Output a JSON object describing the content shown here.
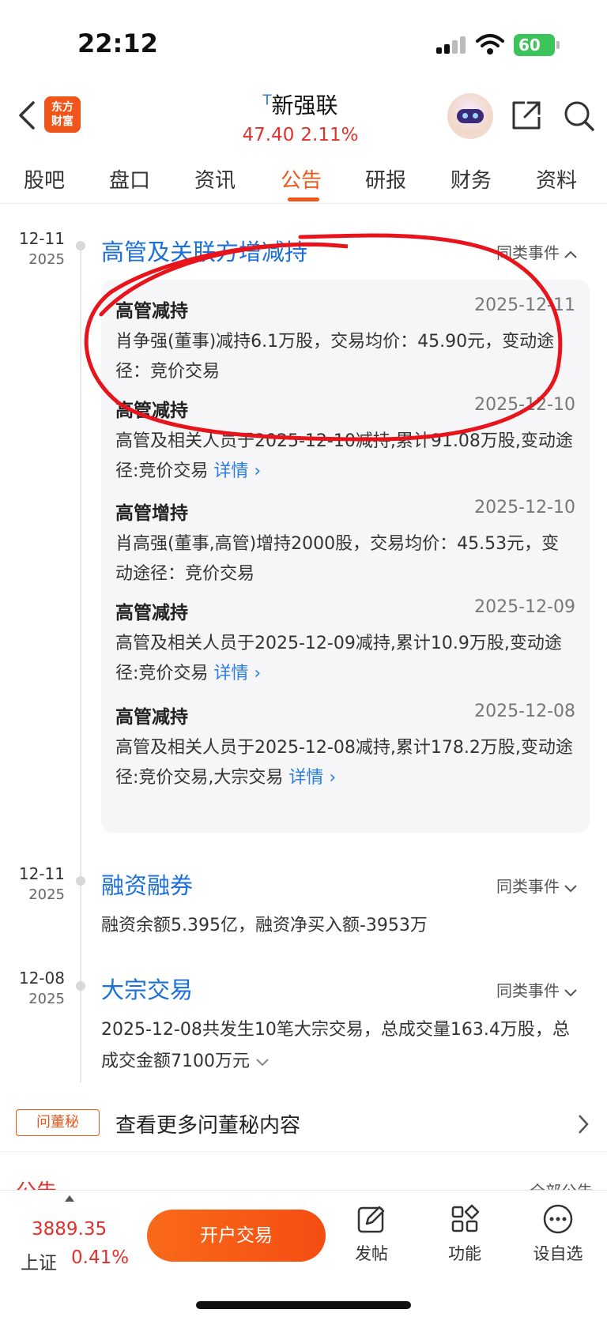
{
  "status_bar": {
    "time": "22:12",
    "battery": "60"
  },
  "header": {
    "logo_line1": "东方",
    "logo_line2": "财富",
    "stock_tag": "T",
    "stock_name": "新强联",
    "price": "47.40",
    "change_pct": "2.11%"
  },
  "tabs": [
    {
      "label": "股吧"
    },
    {
      "label": "盘口"
    },
    {
      "label": "资讯"
    },
    {
      "label": "公告"
    },
    {
      "label": "研报"
    },
    {
      "label": "财务"
    },
    {
      "label": "资料"
    }
  ],
  "active_tab": "公告",
  "events": [
    {
      "date": "12-11",
      "year": "2025",
      "title": "高管及关联方增减持",
      "similar_label": "同类事件",
      "expanded": true,
      "items": [
        {
          "type": "高管减持",
          "date": "2025-12-11",
          "desc": "肖争强(董事)减持6.1万股，交易均价：45.90元，变动途径：竞价交易"
        },
        {
          "type": "高管减持",
          "date": "2025-12-10",
          "desc": "高管及相关人员于2025-12-10减持,累计91.08万股,变动途径:竞价交易",
          "link": "详情 ›"
        },
        {
          "type": "高管增持",
          "date": "2025-12-10",
          "desc": "肖高强(董事,高管)增持2000股，交易均价：45.53元，变动途径：竞价交易"
        },
        {
          "type": "高管减持",
          "date": "2025-12-09",
          "desc": "高管及相关人员于2025-12-09减持,累计10.9万股,变动途径:竞价交易",
          "link": "详情 ›"
        },
        {
          "type": "高管减持",
          "date": "2025-12-08",
          "desc": "高管及相关人员于2025-12-08减持,累计178.2万股,变动途径:竞价交易,大宗交易",
          "link": "详情 ›"
        }
      ]
    },
    {
      "date": "12-11",
      "year": "2025",
      "title": "融资融券",
      "similar_label": "同类事件",
      "desc": "融资余额5.395亿，融资净买入额-3953万"
    },
    {
      "date": "12-08",
      "year": "2025",
      "title": "大宗交易",
      "similar_label": "同类事件",
      "desc": "2025-12-08共发生10笔大宗交易，总成交量163.4万股，总成交金额7100万元"
    }
  ],
  "dongmi": {
    "badge": "问董秘",
    "text": "查看更多问董秘内容"
  },
  "peek": {
    "left": "公告",
    "right": "全部公告"
  },
  "bottom_bar": {
    "index_value": "3889.35",
    "index_name": "上证",
    "index_pct": "0.41%",
    "trade_button": "开户交易",
    "nav": [
      {
        "label": "发帖",
        "icon": "edit-icon"
      },
      {
        "label": "功能",
        "icon": "grid-icon"
      },
      {
        "label": "设自选",
        "icon": "more-circle-icon"
      }
    ]
  },
  "colors": {
    "brand": "#f0561a",
    "up_red": "#e0312c",
    "link_blue": "#2a7de1"
  }
}
